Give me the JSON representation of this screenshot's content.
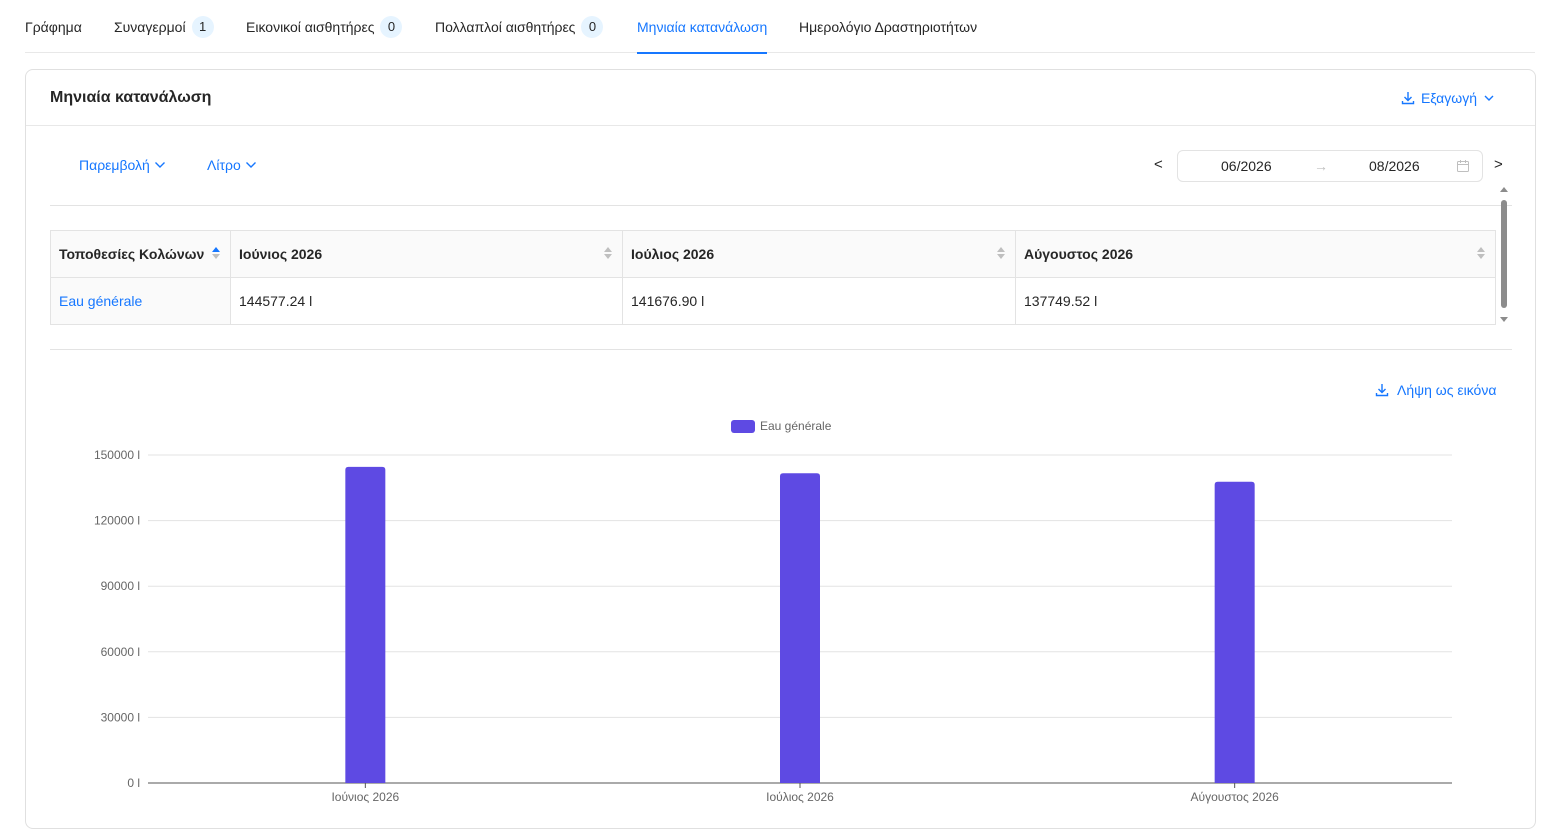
{
  "tabs": [
    {
      "label": "Γράφημα",
      "badge": ""
    },
    {
      "label": "Συναγερμοί",
      "badge": "1"
    },
    {
      "label": "Εικονικοί αισθητήρες",
      "badge": "0"
    },
    {
      "label": "Πολλαπλοί αισθητήρες",
      "badge": "0"
    },
    {
      "label": "Μηνιαία κατανάλωση",
      "badge": "",
      "active": true
    },
    {
      "label": "Ημερολόγιο Δραστηριοτήτων",
      "badge": ""
    }
  ],
  "card": {
    "title": "Μηνιαία κατανάλωση",
    "export_label": "Εξαγωγή"
  },
  "toolbar": {
    "interpolation_label": "Παρεμβολή",
    "unit_label": "Λίτρο",
    "prev_label": "<",
    "next_label": ">",
    "range_start": "06/2026",
    "range_end": "08/2026",
    "range_sep": "→"
  },
  "table": {
    "headers": [
      "Τοποθεσίες Κολώνων",
      "Ιούνιος 2026",
      "Ιούλιος 2026",
      "Αύγουστος 2026"
    ],
    "rows": [
      {
        "name": "Eau générale",
        "values": [
          "144577.24 l",
          "141676.90 l",
          "137749.52 l"
        ]
      }
    ]
  },
  "download_image_label": "Λήψη ως εικόνα",
  "colors": {
    "accent": "#1677ff",
    "bar": "#5e4ae3"
  },
  "chart_data": {
    "type": "bar",
    "categories": [
      "Ιούνιος 2026",
      "Ιούλιος 2026",
      "Αύγουστος 2026"
    ],
    "series": [
      {
        "name": "Eau générale",
        "values": [
          144577.24,
          141676.9,
          137749.52
        ]
      }
    ],
    "ylim": [
      0,
      150000
    ],
    "yticks": [
      0,
      30000,
      60000,
      90000,
      120000,
      150000
    ],
    "ytick_labels": [
      "0 l",
      "30000 l",
      "60000 l",
      "90000 l",
      "120000 l",
      "150000 l"
    ],
    "grid": true,
    "legend": "top-center"
  }
}
